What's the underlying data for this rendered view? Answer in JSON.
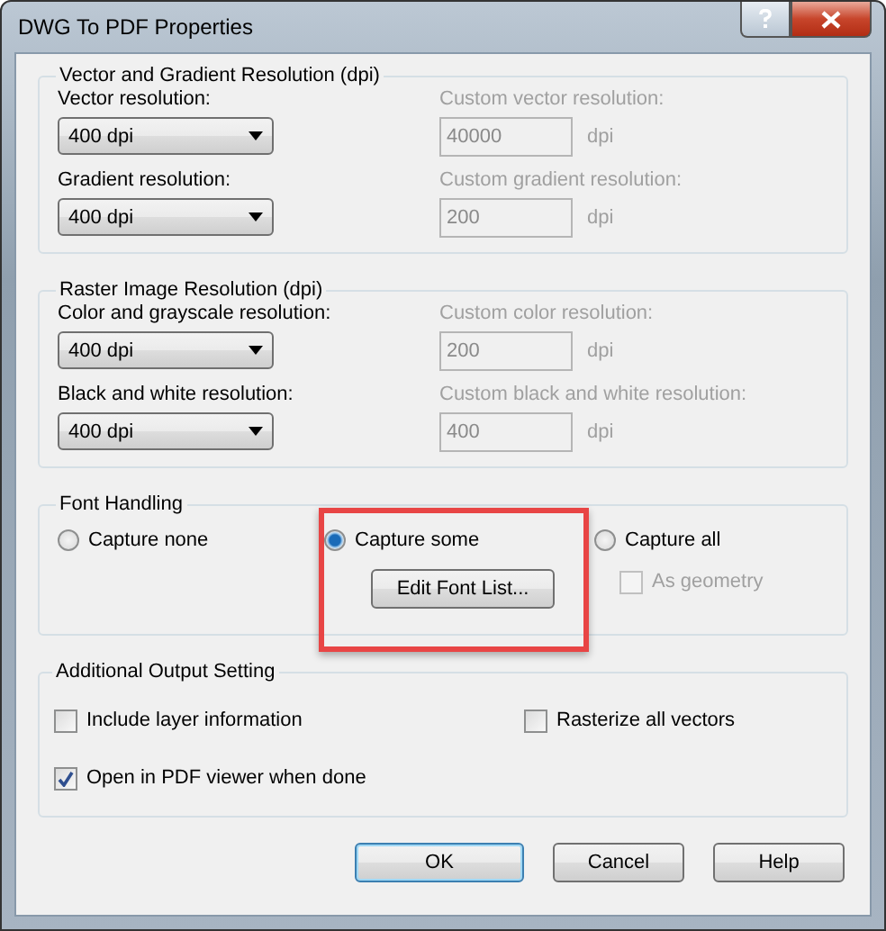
{
  "window": {
    "title": "DWG To PDF Properties"
  },
  "resolution_groups": [
    {
      "title": "Vector and Gradient Resolution (dpi)",
      "rows": [
        {
          "label": "Vector resolution:",
          "value": "400 dpi",
          "custom_label": "Custom vector resolution:",
          "custom_value": "40000",
          "unit": "dpi",
          "custom_disabled": true
        },
        {
          "label": "Gradient resolution:",
          "value": "400 dpi",
          "custom_label": "Custom gradient resolution:",
          "custom_value": "200",
          "unit": "dpi",
          "custom_disabled": true
        }
      ]
    },
    {
      "title": "Raster Image Resolution (dpi)",
      "rows": [
        {
          "label": "Color and grayscale resolution:",
          "value": "400 dpi",
          "custom_label": "Custom color resolution:",
          "custom_value": "200",
          "unit": "dpi",
          "custom_disabled": true
        },
        {
          "label": "Black and white resolution:",
          "value": "400 dpi",
          "custom_label": "Custom black and white resolution:",
          "custom_value": "400",
          "unit": "dpi",
          "custom_disabled": true
        }
      ]
    }
  ],
  "font_handling": {
    "title": "Font Handling",
    "options": [
      {
        "label": "Capture none",
        "selected": false,
        "highlighted": false
      },
      {
        "label": "Capture some",
        "selected": true,
        "highlighted": true,
        "button": "Edit Font List..."
      },
      {
        "label": "Capture all",
        "selected": false,
        "highlighted": false,
        "checkbox": {
          "label": "As geometry",
          "checked": false,
          "disabled": true
        }
      }
    ]
  },
  "additional_output": {
    "title": "Additional Output Setting",
    "options": [
      {
        "label": "Include layer information",
        "checked": false
      },
      {
        "label": "Rasterize all vectors",
        "checked": false
      },
      {
        "label": "Open in PDF viewer when done",
        "checked": true
      }
    ]
  },
  "buttons": [
    {
      "label": "OK",
      "default": true
    },
    {
      "label": "Cancel",
      "default": false
    },
    {
      "label": "Help",
      "default": false
    }
  ]
}
